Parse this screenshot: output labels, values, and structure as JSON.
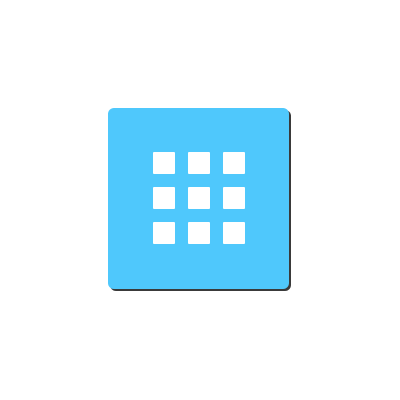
{
  "app_tile": {
    "icon": "apps-grid-icon",
    "background_color": "#4fc8fc",
    "shadow_color": "#3a3a3a",
    "glyph_color": "#ffffff",
    "grid_rows": 3,
    "grid_cols": 3
  }
}
